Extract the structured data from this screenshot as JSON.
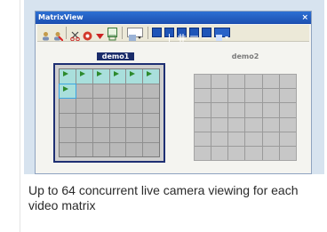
{
  "window": {
    "title": "MatrixView",
    "close_label": "×"
  },
  "toolbar": {
    "icons": [
      "user-icon",
      "user-remove-icon",
      "cut-icon",
      "record-icon",
      "down-arrow-icon",
      "snapshot-icon",
      "layout-dropdown-icon",
      "layout-1-icon",
      "layout-4-icon",
      "layout-9-icon",
      "layout-16-icon",
      "layout-36-icon",
      "settings-dropdown-icon"
    ]
  },
  "matrices": [
    {
      "name": "demo1",
      "active": true
    },
    {
      "name": "demo2",
      "active": false
    }
  ],
  "caption": "Up to 64 concurrent live camera viewing for each video matrix",
  "colors": {
    "titlebar": "#2d6fd3",
    "active_frame": "#1e2f73",
    "panel_bg": "#d7e3ef"
  }
}
